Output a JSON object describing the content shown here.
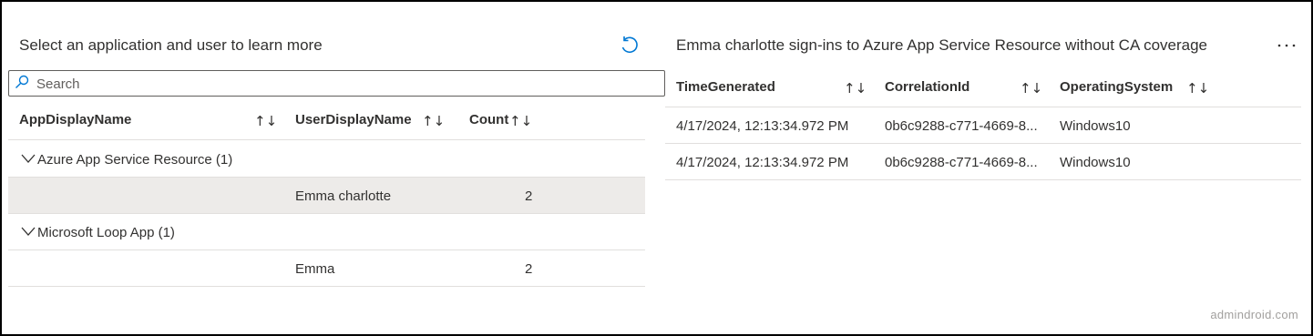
{
  "left_panel": {
    "title": "Select an application and user to learn more",
    "search_placeholder": "Search",
    "columns": [
      "AppDisplayName",
      "UserDisplayName",
      "Count"
    ],
    "groups": [
      {
        "label": "Azure App Service Resource (1)",
        "rows": [
          {
            "user": "Emma charlotte",
            "count": "2"
          }
        ]
      },
      {
        "label": "Microsoft Loop App (1)",
        "rows": [
          {
            "user": "Emma",
            "count": "2"
          }
        ]
      }
    ]
  },
  "right_panel": {
    "title": "Emma charlotte sign-ins to Azure App Service Resource without CA coverage",
    "columns": [
      "TimeGenerated",
      "CorrelationId",
      "OperatingSystem"
    ],
    "rows": [
      {
        "time": "4/17/2024, 12:13:34.972 PM",
        "correlation": "0b6c9288-c771-4669-8...",
        "os": "Windows10"
      },
      {
        "time": "4/17/2024, 12:13:34.972 PM",
        "correlation": "0b6c9288-c771-4669-8...",
        "os": "Windows10"
      }
    ]
  },
  "icons": {
    "refresh": "refresh-icon",
    "search": "search-icon",
    "sort": "sort-icon",
    "chevron": "chevron-down-icon",
    "more": "more-icon"
  },
  "sort_glyph": "↑↓",
  "watermark": "admindroid.com",
  "colors": {
    "accent": "#0078d4",
    "selected_row": "#edebe9",
    "divider": "#e1dfdd",
    "text": "#323130"
  }
}
